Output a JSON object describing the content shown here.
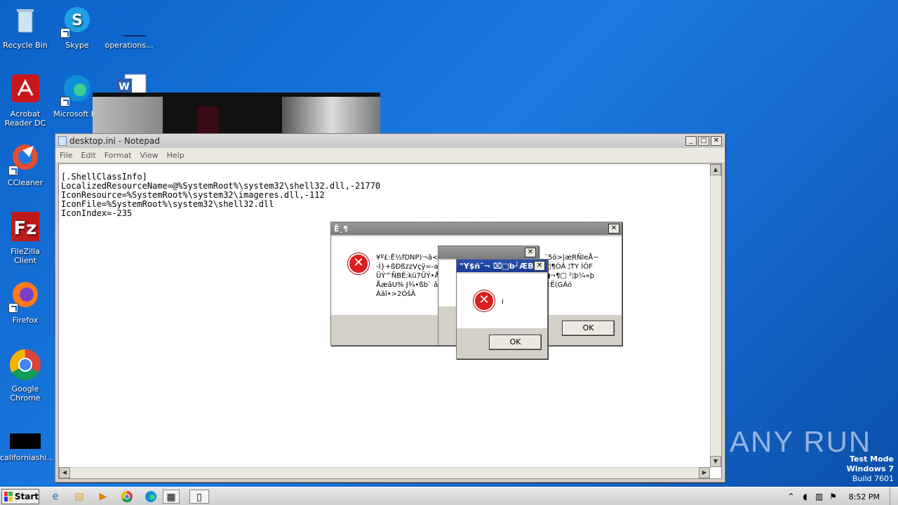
{
  "desktop": {
    "icons": [
      {
        "label": "Recycle Bin",
        "icon": "recycle-bin-icon"
      },
      {
        "label": "Skype",
        "icon": "skype-icon"
      },
      {
        "label": "operations...",
        "icon": "file-icon"
      },
      {
        "label": "Acrobat Reader DC",
        "icon": "acrobat-icon"
      },
      {
        "label": "Microsoft Ed",
        "icon": "edge-icon"
      },
      {
        "label": "CCleaner",
        "icon": "ccleaner-icon"
      },
      {
        "label": "FileZilla Client",
        "icon": "filezilla-icon"
      },
      {
        "label": "Firefox",
        "icon": "firefox-icon"
      },
      {
        "label": "Google Chrome",
        "icon": "chrome-icon"
      },
      {
        "label": "californiashi...",
        "icon": "file-icon"
      }
    ]
  },
  "notepad": {
    "title": "desktop.ini - Notepad",
    "menu": [
      "File",
      "Edit",
      "Format",
      "View",
      "Help"
    ],
    "content": "[.ShellClassInfo]\nLocalizedResourceName=@%SystemRoot%\\system32\\shell32.dll,-21770\nIconResource=%SystemRoot%\\system32\\imageres.dll,-112\nIconFile=%SystemRoot%\\system32\\shell32.dll\nIconIndex=-235"
  },
  "dialogs": {
    "d1": {
      "title": "Ê¸¶",
      "text_left": "¥º£:Ê½fDNP)¬â<\n-Ì}+ßÐßzzVçÿ=-aÞ\nÜÝ^ÑBÈ:kü7ÜÝ•ÅÉ\nÅæâU% J¾•ßb` âó\nÀäî•>2ÒšÂ",
      "text_right": "¨5ö>|æRÑleÅ~\n□¶ÓÂ ¦TY ÌÔF\n◀¬¶□ ²¦þ¼»þ\n<Ë(GÁó",
      "ok": "OK"
    },
    "d2": {
      "title": "",
      "ok": "OK"
    },
    "d3": {
      "title": "\"Y$ñ¨¬ ⌧□b┘ÆB",
      "text": "i",
      "ok": "OK"
    }
  },
  "taskbar": {
    "start": "Start",
    "time": "8:52 PM"
  },
  "watermark": {
    "brand": "ANY RUN",
    "line1": "Test Mode",
    "line2": "Windows 7",
    "line3": "Build 7601"
  }
}
